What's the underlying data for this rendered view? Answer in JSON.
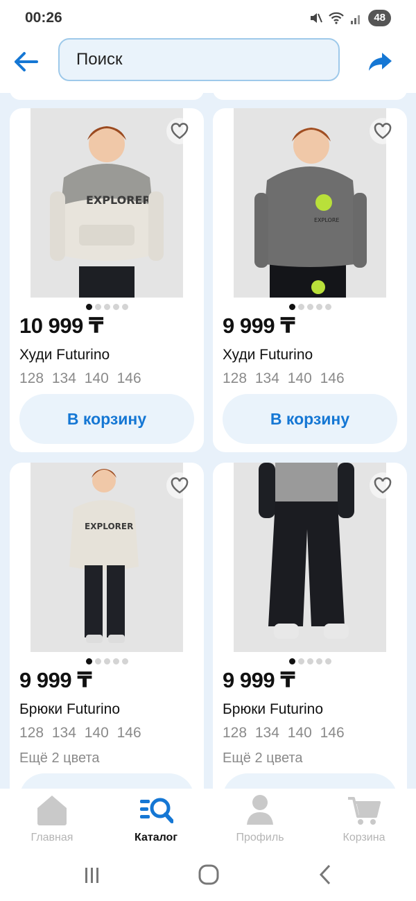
{
  "status": {
    "time": "00:26",
    "battery": "48"
  },
  "header": {
    "search_placeholder": "Поиск"
  },
  "products": [
    {
      "price": "10 999 ₸",
      "name": "Худи Futurino",
      "sizes": "128 134 140 146",
      "cart_label": "В корзину"
    },
    {
      "price": "9 999 ₸",
      "name": "Худи Futurino",
      "sizes": "128 134 140 146",
      "cart_label": "В корзину"
    },
    {
      "price": "9 999 ₸",
      "name": "Брюки Futurino",
      "sizes": "128 134 140 146",
      "colors": "Ещё 2 цвета"
    },
    {
      "price": "9 999 ₸",
      "name": "Брюки Futurino",
      "sizes": "128 134 140 146",
      "colors": "Ещё 2 цвета"
    }
  ],
  "nav": {
    "items": [
      {
        "label": "Главная",
        "icon": "home-icon"
      },
      {
        "label": "Каталог",
        "icon": "catalog-icon",
        "active": true
      },
      {
        "label": "Профиль",
        "icon": "profile-icon"
      },
      {
        "label": "Корзина",
        "icon": "cart-icon"
      }
    ]
  },
  "colors": {
    "accent": "#1577d4",
    "page_bg": "#e8f1fa",
    "button_bg": "#eaf3fb"
  }
}
